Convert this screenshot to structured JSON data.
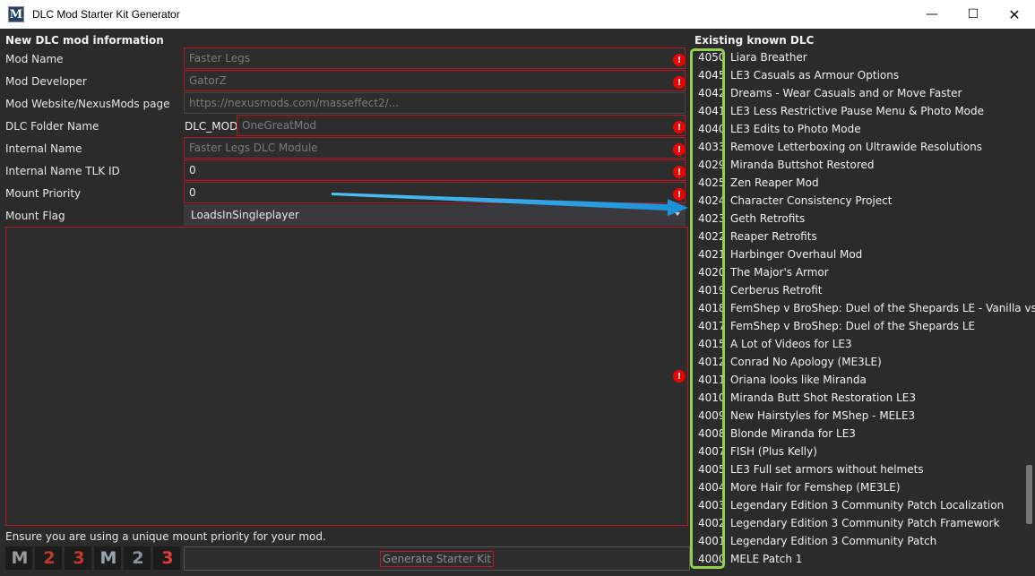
{
  "window": {
    "title": "DLC Mod Starter Kit Generator",
    "icon_letter": "M",
    "minimize_glyph": "—",
    "maximize_glyph": "☐",
    "close_glyph": "✕"
  },
  "form": {
    "heading": "New DLC mod information",
    "mod_name": {
      "label": "Mod Name",
      "placeholder": "Faster Legs"
    },
    "mod_developer": {
      "label": "Mod Developer",
      "placeholder": "GatorZ"
    },
    "mod_website": {
      "label": "Mod Website/NexusMods page",
      "placeholder": "https://nexusmods.com/masseffect2/..."
    },
    "dlc_folder": {
      "label": "DLC Folder Name",
      "prefix": "DLC_MOD_",
      "placeholder": "OneGreatMod"
    },
    "internal_name": {
      "label": "Internal Name",
      "placeholder": "Faster Legs DLC Module"
    },
    "tlk_id": {
      "label": "Internal Name TLK ID",
      "value": "0"
    },
    "mount_priority": {
      "label": "Mount Priority",
      "value": "0"
    },
    "mount_flag": {
      "label": "Mount Flag",
      "value": "LoadsInSingleplayer"
    },
    "error_glyph": "!",
    "notice": "Ensure you are using a unique mount priority for your mod.",
    "generate_label": "Generate Starter Kit",
    "logos": [
      {
        "text": "M",
        "color": "#9a9a9a"
      },
      {
        "text": "2",
        "color": "#c0392b"
      },
      {
        "text": "3",
        "color": "#c0392b"
      },
      {
        "text": "M",
        "color": "#9aa4b0"
      },
      {
        "text": "2",
        "color": "#8a8f9a"
      },
      {
        "text": "3",
        "color": "#e23b3b"
      }
    ]
  },
  "dlc_list": {
    "heading": "Existing known DLC",
    "items": [
      {
        "id": "4050",
        "name": "Liara Breather"
      },
      {
        "id": "4045",
        "name": "LE3 Casuals as Armour Options"
      },
      {
        "id": "4042",
        "name": "Dreams - Wear Casuals and or Move Faster"
      },
      {
        "id": "4041",
        "name": "LE3 Less Restrictive Pause Menu & Photo Mode"
      },
      {
        "id": "4040",
        "name": "LE3 Edits to Photo Mode"
      },
      {
        "id": "4033",
        "name": "Remove Letterboxing on Ultrawide Resolutions"
      },
      {
        "id": "4029",
        "name": "Miranda Buttshot Restored"
      },
      {
        "id": "4025",
        "name": "Zen Reaper Mod"
      },
      {
        "id": "4024",
        "name": "Character Consistency Project"
      },
      {
        "id": "4023",
        "name": "Geth Retrofits"
      },
      {
        "id": "4022",
        "name": "Reaper Retrofits"
      },
      {
        "id": "4021",
        "name": "Harbinger Overhaul Mod"
      },
      {
        "id": "4020",
        "name": "The Major's Armor"
      },
      {
        "id": "4019",
        "name": "Cerberus Retrofit"
      },
      {
        "id": "4018",
        "name": "FemShep v BroShep: Duel of the Shepards LE - Vanilla vs"
      },
      {
        "id": "4017",
        "name": "FemShep v BroShep: Duel of the Shepards LE"
      },
      {
        "id": "4015",
        "name": "A Lot of Videos for LE3"
      },
      {
        "id": "4012",
        "name": "Conrad No Apology (ME3LE)"
      },
      {
        "id": "4011",
        "name": "Oriana looks like Miranda"
      },
      {
        "id": "4010",
        "name": "Miranda Butt Shot Restoration LE3"
      },
      {
        "id": "4009",
        "name": "New Hairstyles for MShep - MELE3"
      },
      {
        "id": "4008",
        "name": "Blonde Miranda for LE3"
      },
      {
        "id": "4007",
        "name": "FISH (Plus Kelly)"
      },
      {
        "id": "4005",
        "name": "LE3 Full set armors without helmets"
      },
      {
        "id": "4004",
        "name": "More Hair for Femshep (ME3LE)"
      },
      {
        "id": "4003",
        "name": "Legendary Edition 3 Community Patch Localization"
      },
      {
        "id": "4002",
        "name": "Legendary Edition 3 Community Patch Framework"
      },
      {
        "id": "4001",
        "name": "Legendary Edition 3 Community Patch"
      },
      {
        "id": "4000",
        "name": "MELE Patch 1"
      }
    ]
  },
  "colors": {
    "error_border": "#b01822",
    "highlight": "#8fd14f",
    "arrow": "#1ea7e8"
  }
}
